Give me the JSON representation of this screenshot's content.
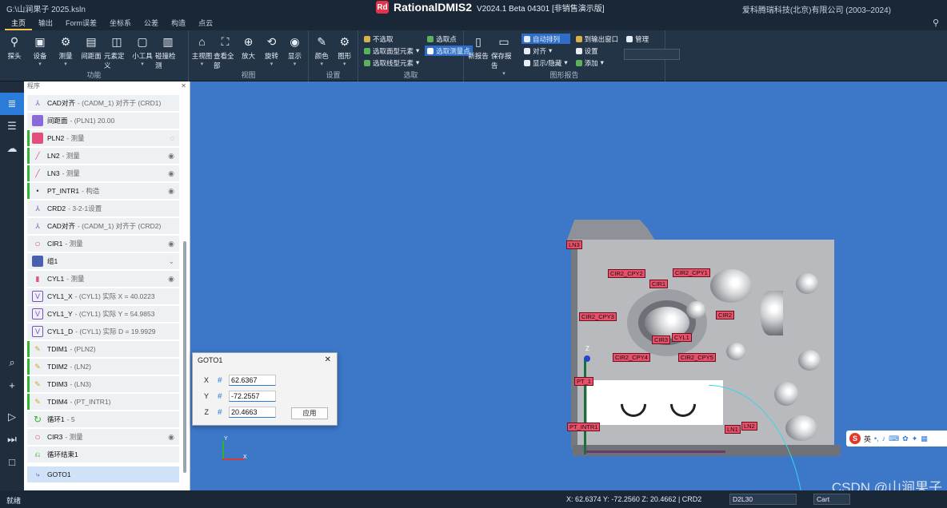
{
  "title": {
    "path": "G:\\山涧果子 2025.ksln",
    "app_name": "RationalDMIS2",
    "logo_text": "Rd",
    "version": "V2024.1 Beta 04301 [非销售演示版]",
    "copyright": "爱科腾瑞科技(北京)有限公司 (2003–2024)"
  },
  "menu": [
    "主页",
    "输出",
    "Form误差",
    "坐标系",
    "公差",
    "构造",
    "点云"
  ],
  "ribbon": {
    "func_group": {
      "label": "功能",
      "buttons": [
        "探头",
        "设备",
        "测量",
        "间距面",
        "元素定义",
        "小工具",
        "碰撞检测"
      ]
    },
    "view_group": {
      "label": "视图",
      "buttons": [
        "主视图",
        "查看全部",
        "放大",
        "旋转",
        "显示"
      ]
    },
    "settings_group": {
      "label": "设置",
      "buttons": [
        "颜色",
        "图形"
      ]
    },
    "select_group": {
      "label": "选取",
      "items": [
        "不选取",
        "选取面型元素",
        "选取线型元素",
        "选取点",
        "选取测量点"
      ]
    },
    "report_group": {
      "label": "图形报告",
      "buttons": [
        "新报告",
        "保存报告"
      ],
      "items": [
        "自动排列",
        "对齐",
        "显示/隐藏",
        "到输出窗口",
        "设置",
        "添加",
        "管理"
      ]
    }
  },
  "panel": {
    "header": "程序",
    "rows": [
      {
        "name": "CAD对齐",
        "detail": "- (CADM_1) 对齐于 (CRD1)"
      },
      {
        "name": "间距面",
        "detail": "- (PLN1) 20.00"
      },
      {
        "name": "PLN2",
        "detail": "- 测量"
      },
      {
        "name": "LN2",
        "detail": "- 测量"
      },
      {
        "name": "LN3",
        "detail": "- 测量"
      },
      {
        "name": "PT_INTR1",
        "detail": "- 构造"
      },
      {
        "name": "CRD2",
        "detail": "- 3-2-1设置"
      },
      {
        "name": "CAD对齐",
        "detail": "- (CADM_1) 对齐于 (CRD2)"
      },
      {
        "name": "CIR1",
        "detail": "- 测量"
      },
      {
        "name": "组1",
        "detail": ""
      },
      {
        "name": "CYL1",
        "detail": "- 测量"
      },
      {
        "name": "CYL1_X",
        "detail": "- (CYL1) 实际 X = 40.0223"
      },
      {
        "name": "CYL1_Y",
        "detail": "- (CYL1) 实际 Y = 54.9853"
      },
      {
        "name": "CYL1_D",
        "detail": "- (CYL1) 实际 D = 19.9929"
      },
      {
        "name": "TDIM1",
        "detail": "- (PLN2)"
      },
      {
        "name": "TDIM2",
        "detail": "- (LN2)"
      },
      {
        "name": "TDIM3",
        "detail": "- (LN3)"
      },
      {
        "name": "TDIM4",
        "detail": "- (PT_INTR1)"
      },
      {
        "name": "循环1",
        "detail": "- 5"
      },
      {
        "name": "CIR3",
        "detail": "- 测量"
      },
      {
        "name": "循环结束1",
        "detail": ""
      },
      {
        "name": "GOTO1",
        "detail": ""
      }
    ]
  },
  "viewport": {
    "labels": [
      "LN3",
      "CIR2_CPY2",
      "CIR2_CPY1",
      "CIR1",
      "CIR2_CPY3",
      "CIR2",
      "CIR3",
      "CYL1",
      "CIR2_CPY4",
      "CIR2_CPY5",
      "PT_1",
      "PT_INTR1",
      "LN1",
      "LN2"
    ],
    "axis_z": "Z",
    "triad_x": "X",
    "triad_y": "Y"
  },
  "dialog": {
    "title": "GOTO1",
    "x_label": "X",
    "x_value": "62.6367",
    "y_label": "Y",
    "y_value": "-72.2557",
    "z_label": "Z",
    "z_value": "20.4663",
    "apply": "应用"
  },
  "ime": {
    "s": "S",
    "lang": "英"
  },
  "watermark": "CSDN @山涧果子",
  "status": {
    "left": "就绪",
    "coords": "X: 62.6374   Y: -72.2560   Z: 20.4662  |  CRD2",
    "select1": "D2L30",
    "select2": "Cart"
  },
  "colors": {
    "accent": "#2b7bd8",
    "viewport_bg": "#3c77c8",
    "label_bg": "#e8506a",
    "logo": "#e3334a"
  }
}
